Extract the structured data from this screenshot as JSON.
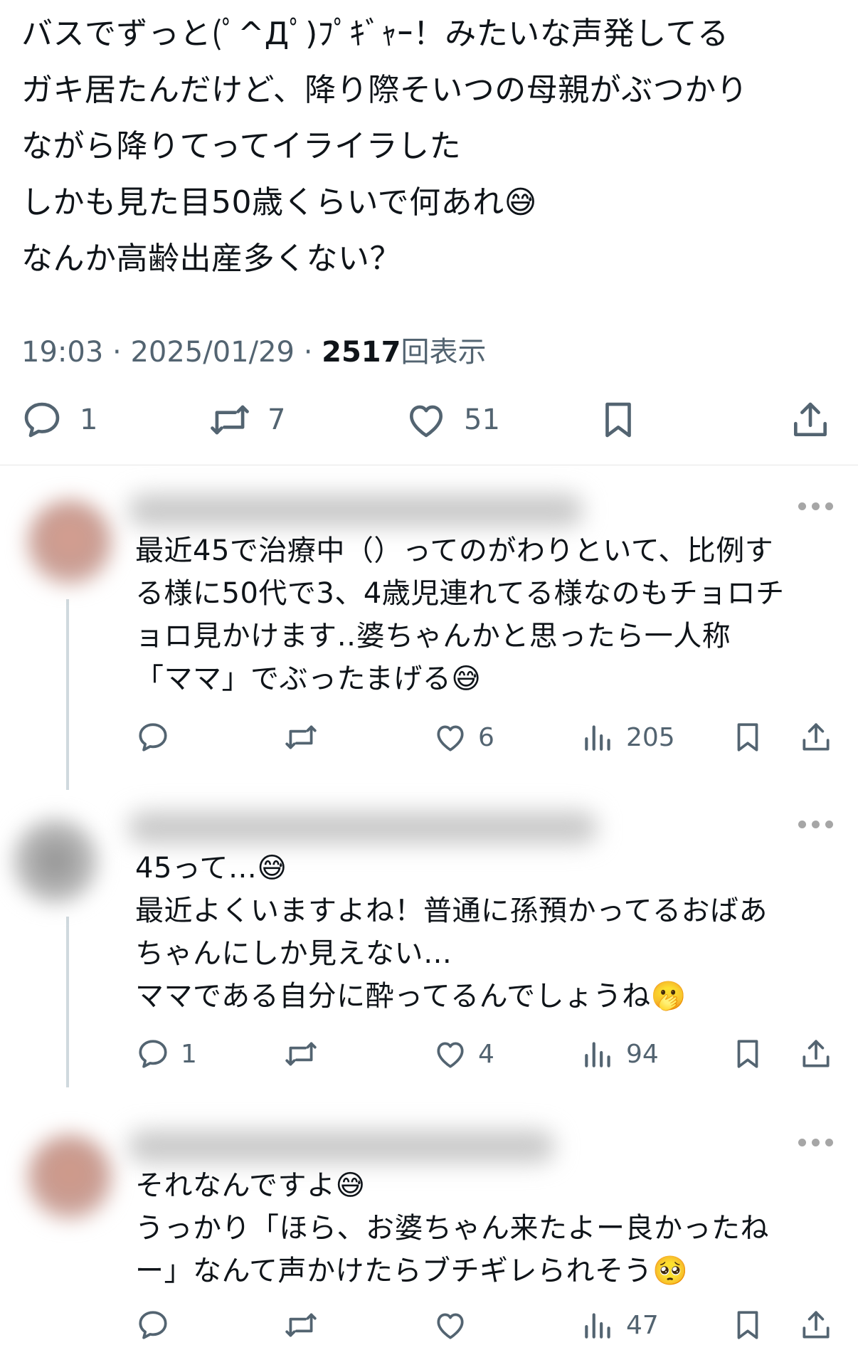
{
  "tweet": {
    "text": "バスでずっと(ﾟ^Дﾟ)ﾌﾟｷﾞｬｰ！みたいな声発してる\nガキ居たんだけど、降り際そいつの母親がぶつかり\nながら降りてってイライラした\nしかも見た目50歳くらいで何あれ😅\nなんか高齢出産多くない？",
    "time": "19:03",
    "date": "2025/01/29",
    "views": "2517",
    "views_label": "回表示",
    "replies": "1",
    "retweets": "7",
    "likes": "51"
  },
  "replies": [
    {
      "text": "最近45で治療中（）ってのがわりといて、比例す\nる様に50代で3、4歳児連れてる様なのもチョロチ\nョロ見かけます‥婆ちゃんかと思ったら一人称\n「ママ」でぶったまげる😅",
      "replies": "",
      "retweets": "",
      "likes": "6",
      "views": "205"
    },
    {
      "text": "45って…😅\n最近よくいますよね！普通に孫預かってるおばあ\nちゃんにしか見えない…\nママである自分に酔ってるんでしょうね🫢",
      "replies": "1",
      "retweets": "",
      "likes": "4",
      "views": "94"
    },
    {
      "text": "それなんですよ😅\nうっかり「ほら、お婆ちゃん来たよー良かったね\nー」なんて声かけたらブチギレられそう🥺",
      "replies": "",
      "retweets": "",
      "likes": "",
      "views": "47"
    }
  ],
  "colors": {
    "text": "#0f1419",
    "secondary": "#536471",
    "thread_line": "#cfd9de"
  }
}
